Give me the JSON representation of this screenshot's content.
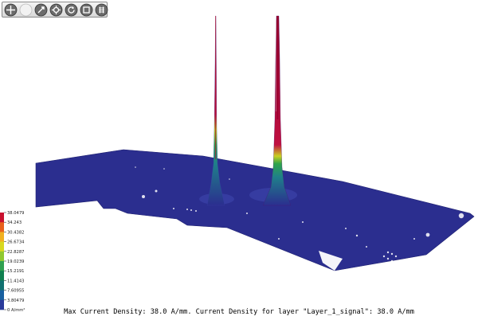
{
  "toolbar": {
    "buttons": [
      {
        "icon": "rotate-view-icon"
      },
      {
        "icon": "blank-circle-icon"
      },
      {
        "icon": "pan-view-icon"
      },
      {
        "icon": "zoom-view-icon"
      },
      {
        "icon": "reset-view-icon"
      },
      {
        "icon": "fit-window-icon"
      },
      {
        "icon": "grid-settings-icon"
      }
    ]
  },
  "legend": {
    "labels": [
      "38.0479",
      "34.243",
      "30.4382",
      "26.6734",
      "22.8287",
      "19.0239",
      "15.2191",
      "11.4143",
      "7.60955",
      "3.80479",
      "0 A/mm²"
    ],
    "colors": [
      "#c8102e",
      "#e8601c",
      "#f0b020",
      "#d8d820",
      "#90c830",
      "#30a050",
      "#108050",
      "#107070",
      "#1860a0",
      "#2a3a9a",
      "#2b2e8f"
    ]
  },
  "plot": {
    "board_color": "#2b2e8f",
    "peak_color_top": "#c8102e"
  },
  "status": {
    "text": "Max Current Density: 38.0 A/mm. Current Density for layer \"Layer_1_signal\": 38.0 A/mm"
  }
}
